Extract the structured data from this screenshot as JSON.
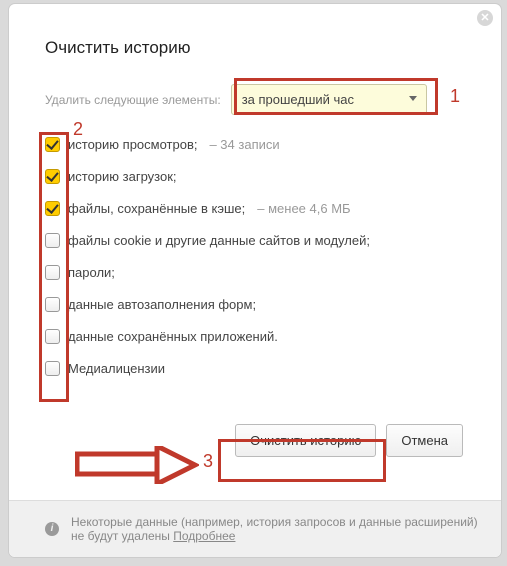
{
  "title": "Очистить историю",
  "timerange": {
    "label": "Удалить следующие элементы:",
    "selected": "за прошедший час"
  },
  "options": [
    {
      "label": "историю просмотров;",
      "suffix": "  –   34 записи",
      "checked": true
    },
    {
      "label": "историю загрузок;",
      "suffix": "",
      "checked": true
    },
    {
      "label": "файлы, сохранённые в кэше;",
      "suffix": "  –   менее 4,6 МБ",
      "checked": true
    },
    {
      "label": "файлы cookie и другие данные сайтов и модулей;",
      "suffix": "",
      "checked": false
    },
    {
      "label": "пароли;",
      "suffix": "",
      "checked": false
    },
    {
      "label": "данные автозаполнения форм;",
      "suffix": "",
      "checked": false
    },
    {
      "label": "данные сохранённых приложений.",
      "suffix": "",
      "checked": false
    },
    {
      "label": "Медиалицензии",
      "suffix": "",
      "checked": false
    }
  ],
  "buttons": {
    "clear": "Очистить историю",
    "cancel": "Отмена"
  },
  "footer": {
    "text": "Некоторые данные (например, история запросов и данные расширений) не будут удалены ",
    "link": "Подробнее"
  },
  "annotations": {
    "n1": "1",
    "n2": "2",
    "n3": "3"
  }
}
